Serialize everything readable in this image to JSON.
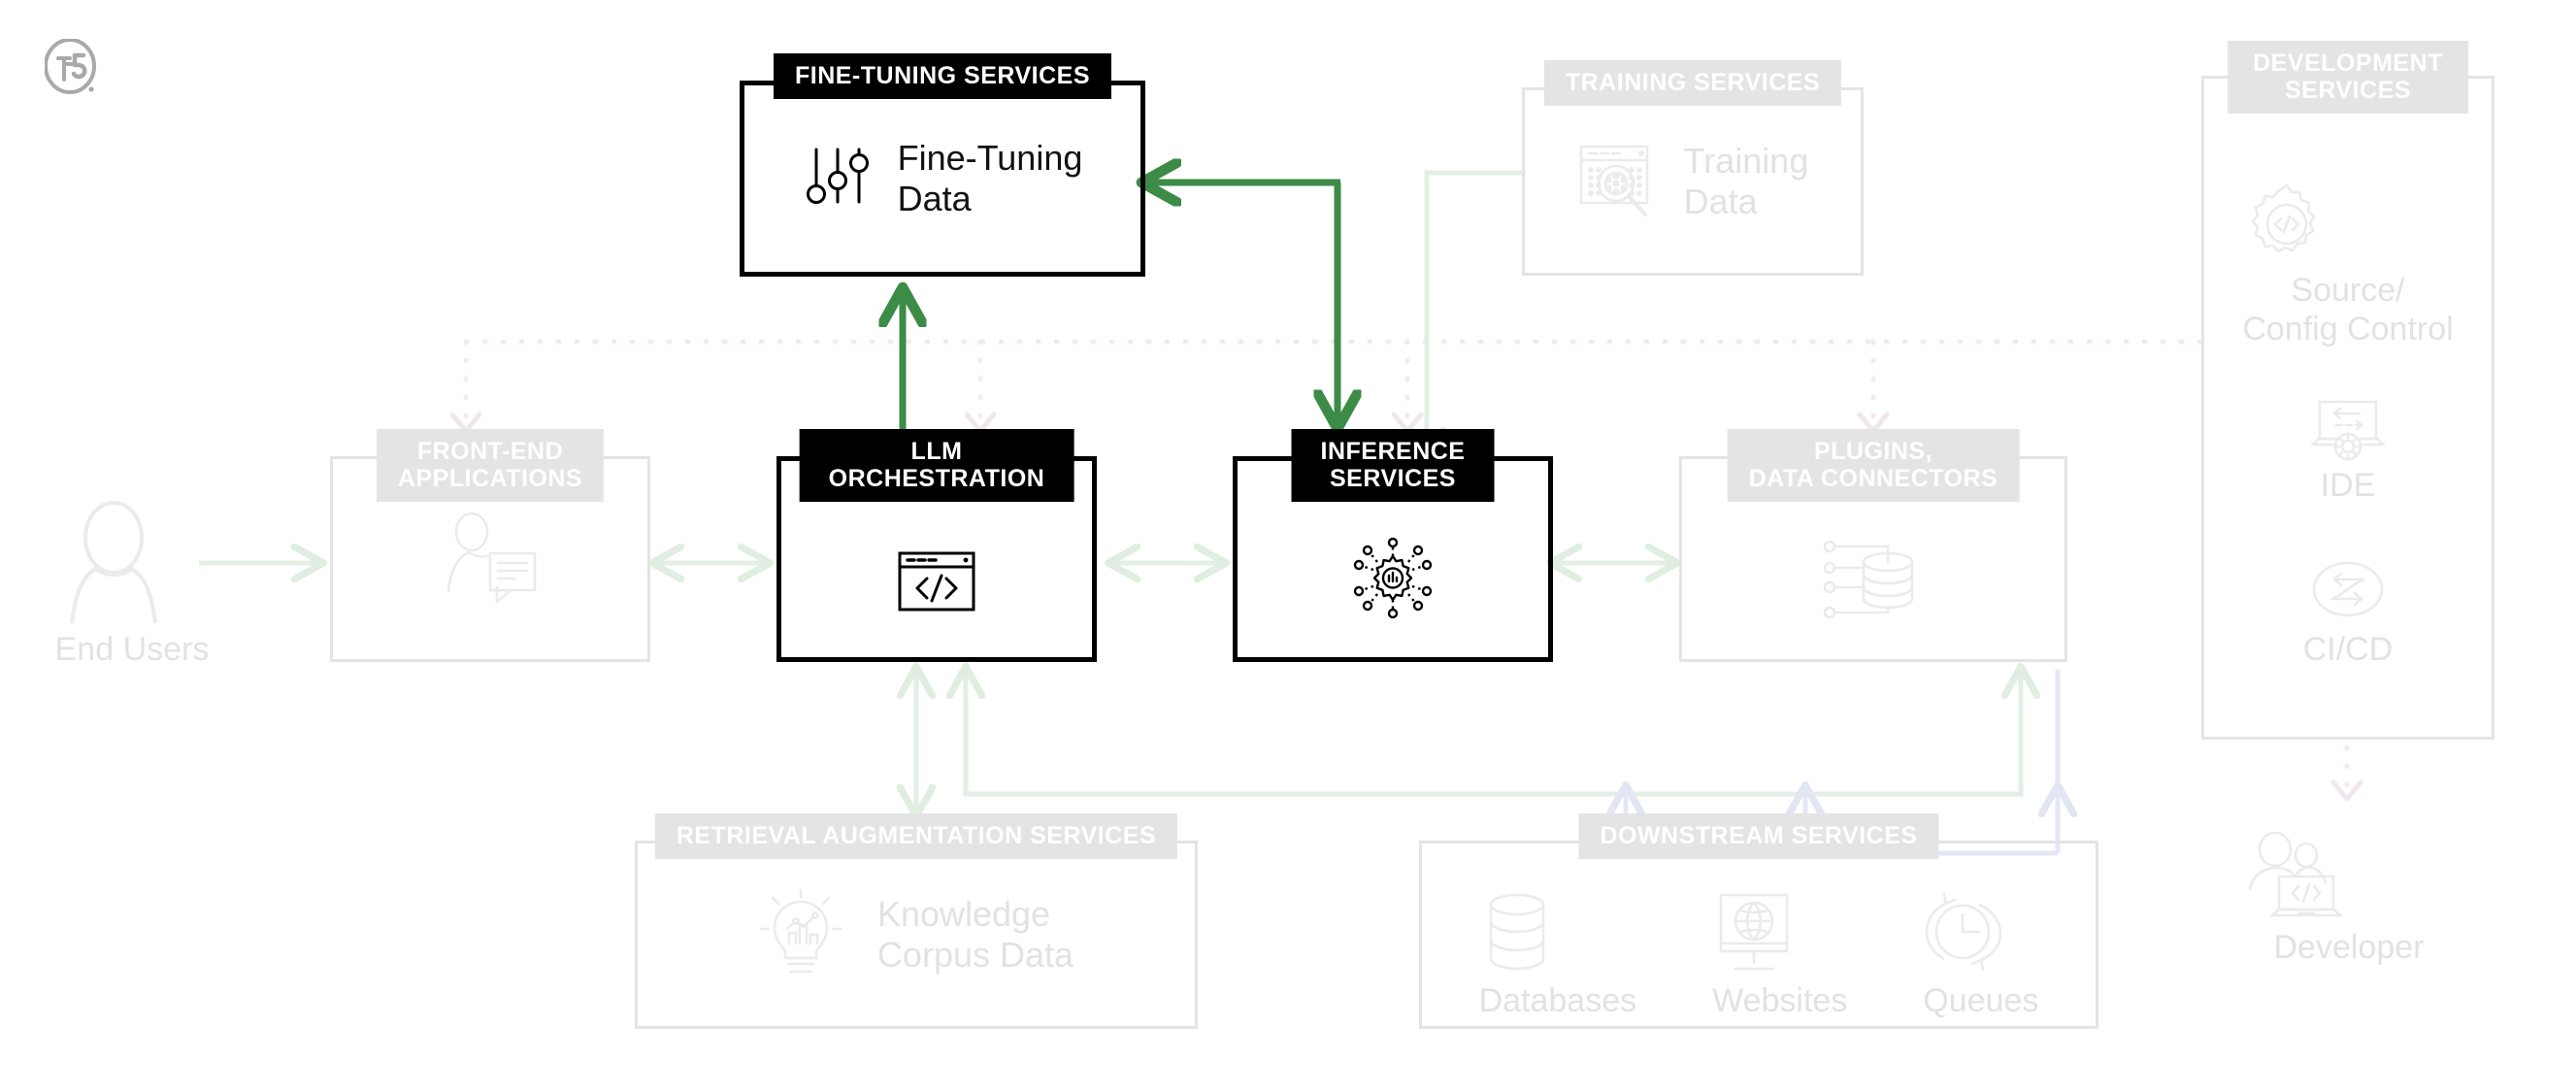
{
  "brand": {
    "logo_name": "f5-logo"
  },
  "colors": {
    "accent_green": "#3c8b46",
    "faded_green": "#e3efe4",
    "faded_blue": "#e4e7f4",
    "faded_pink": "#f5eaf0",
    "muted_gray": "#e4e4e4",
    "text_muted": "#e2e2e2",
    "black": "#000000"
  },
  "boxes": {
    "fine_tuning": {
      "badge": "FINE-TUNING SERVICES",
      "label": "Fine-Tuning\nData",
      "label_line1": "Fine-Tuning",
      "label_line2": "Data",
      "icon": "sliders-icon",
      "state": "active"
    },
    "training": {
      "badge": "TRAINING SERVICES",
      "label_line1": "Training",
      "label_line2": "Data",
      "icon": "data-inspect-icon",
      "state": "muted"
    },
    "front_end": {
      "badge_line1": "FRONT-END",
      "badge_line2": "APPLICATIONS",
      "icon": "user-chat-icon",
      "state": "muted"
    },
    "llm_orchestration": {
      "badge_line1": "LLM",
      "badge_line2": "ORCHESTRATION",
      "icon": "code-window-icon",
      "state": "active"
    },
    "inference": {
      "badge_line1": "INFERENCE",
      "badge_line2": "SERVICES",
      "icon": "inference-gear-icon",
      "state": "active"
    },
    "plugins": {
      "badge_line1": "PLUGINS,",
      "badge_line2": "DATA CONNECTORS",
      "icon": "database-connectors-icon",
      "state": "muted"
    },
    "retrieval": {
      "badge": "RETRIEVAL AUGMENTATION SERVICES",
      "label_line1": "Knowledge",
      "label_line2": "Corpus Data",
      "icon": "lightbulb-chart-icon",
      "state": "muted"
    },
    "downstream": {
      "badge": "DOWNSTREAM SERVICES",
      "state": "muted",
      "items": [
        {
          "cap": "Databases",
          "icon": "database-icon"
        },
        {
          "cap": "Websites",
          "icon": "monitor-globe-icon"
        },
        {
          "cap": "Queues",
          "icon": "clock-cycle-icon"
        }
      ]
    },
    "development": {
      "badge_line1": "DEVELOPMENT",
      "badge_line2": "SERVICES",
      "state": "muted",
      "items": [
        {
          "cap_line1": "Source/",
          "cap_line2": "Config Control",
          "icon": "gear-code-icon"
        },
        {
          "cap_line1": "IDE",
          "cap_line2": "",
          "icon": "laptop-gear-icon"
        },
        {
          "cap_line1": "CI/CD",
          "cap_line2": "",
          "icon": "cicd-loop-icon"
        }
      ]
    }
  },
  "actors": {
    "end_users": {
      "cap": "End Users",
      "icon": "person-icon"
    },
    "developer": {
      "cap": "Developer",
      "icon": "developer-laptop-icon"
    }
  },
  "connectors": [
    {
      "name": "llm-to-finetuning",
      "style": "solid-green",
      "direction": "up"
    },
    {
      "name": "finetuning-to-inference",
      "style": "solid-green",
      "direction": "down-left-elbow"
    },
    {
      "name": "endusers-to-frontend",
      "style": "faded-green",
      "direction": "right"
    },
    {
      "name": "frontend-to-llm",
      "style": "faded-green",
      "direction": "bidirectional"
    },
    {
      "name": "llm-to-inference",
      "style": "faded-green",
      "direction": "bidirectional"
    },
    {
      "name": "inference-to-plugins",
      "style": "faded-green",
      "direction": "bidirectional"
    },
    {
      "name": "llm-to-retrieval",
      "style": "faded-green",
      "direction": "bidirectional"
    },
    {
      "name": "llm-to-plugins-loop",
      "style": "faded-green",
      "direction": "elbow"
    },
    {
      "name": "plugins-to-downstream",
      "style": "faded-blue",
      "direction": "fanout-down"
    },
    {
      "name": "dev-bus",
      "style": "dotted-pink",
      "direction": "horizontal"
    },
    {
      "name": "dev-to-frontend",
      "style": "dotted-pink",
      "direction": "down"
    },
    {
      "name": "dev-to-llm",
      "style": "dotted-pink",
      "direction": "down"
    },
    {
      "name": "dev-to-inference",
      "style": "dotted-pink",
      "direction": "down"
    },
    {
      "name": "dev-to-plugins",
      "style": "dotted-pink",
      "direction": "down"
    },
    {
      "name": "cicd-to-developer",
      "style": "dotted-pink",
      "direction": "down"
    },
    {
      "name": "training-to-inference",
      "style": "faded-green",
      "direction": "down-elbow"
    }
  ]
}
